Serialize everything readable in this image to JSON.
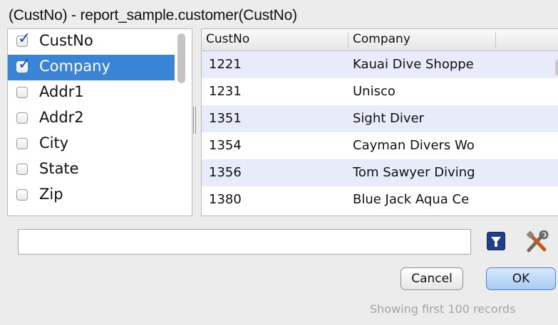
{
  "dialog": {
    "title": "(CustNo) - report_sample.customer(CustNo)"
  },
  "field_list": {
    "items": [
      {
        "label": "CustNo",
        "checked": true,
        "selected": false
      },
      {
        "label": "Company",
        "checked": true,
        "selected": true
      },
      {
        "label": "Addr1",
        "checked": false,
        "selected": false
      },
      {
        "label": "Addr2",
        "checked": false,
        "selected": false
      },
      {
        "label": "City",
        "checked": false,
        "selected": false
      },
      {
        "label": "State",
        "checked": false,
        "selected": false
      },
      {
        "label": "Zip",
        "checked": false,
        "selected": false
      }
    ]
  },
  "grid": {
    "columns": [
      "CustNo",
      "Company"
    ],
    "rows": [
      [
        "1221",
        "Kauai Dive Shoppe"
      ],
      [
        "1231",
        "Unisco"
      ],
      [
        "1351",
        "Sight Diver"
      ],
      [
        "1354",
        "Cayman Divers Wo"
      ],
      [
        "1356",
        "Tom Sawyer Diving"
      ],
      [
        "1380",
        "Blue Jack Aqua Ce"
      ]
    ]
  },
  "filter": {
    "value": "",
    "placeholder": ""
  },
  "icons": {
    "filter": "filter-icon",
    "tools": "tools-icon"
  },
  "buttons": {
    "cancel_label": "Cancel",
    "ok_label": "OK"
  },
  "status": {
    "text": "Showing first 100 records"
  },
  "colors": {
    "selection": "#3a84d8",
    "alt_row": "#e8ecfa",
    "ok_button": "#a9cbf3"
  }
}
